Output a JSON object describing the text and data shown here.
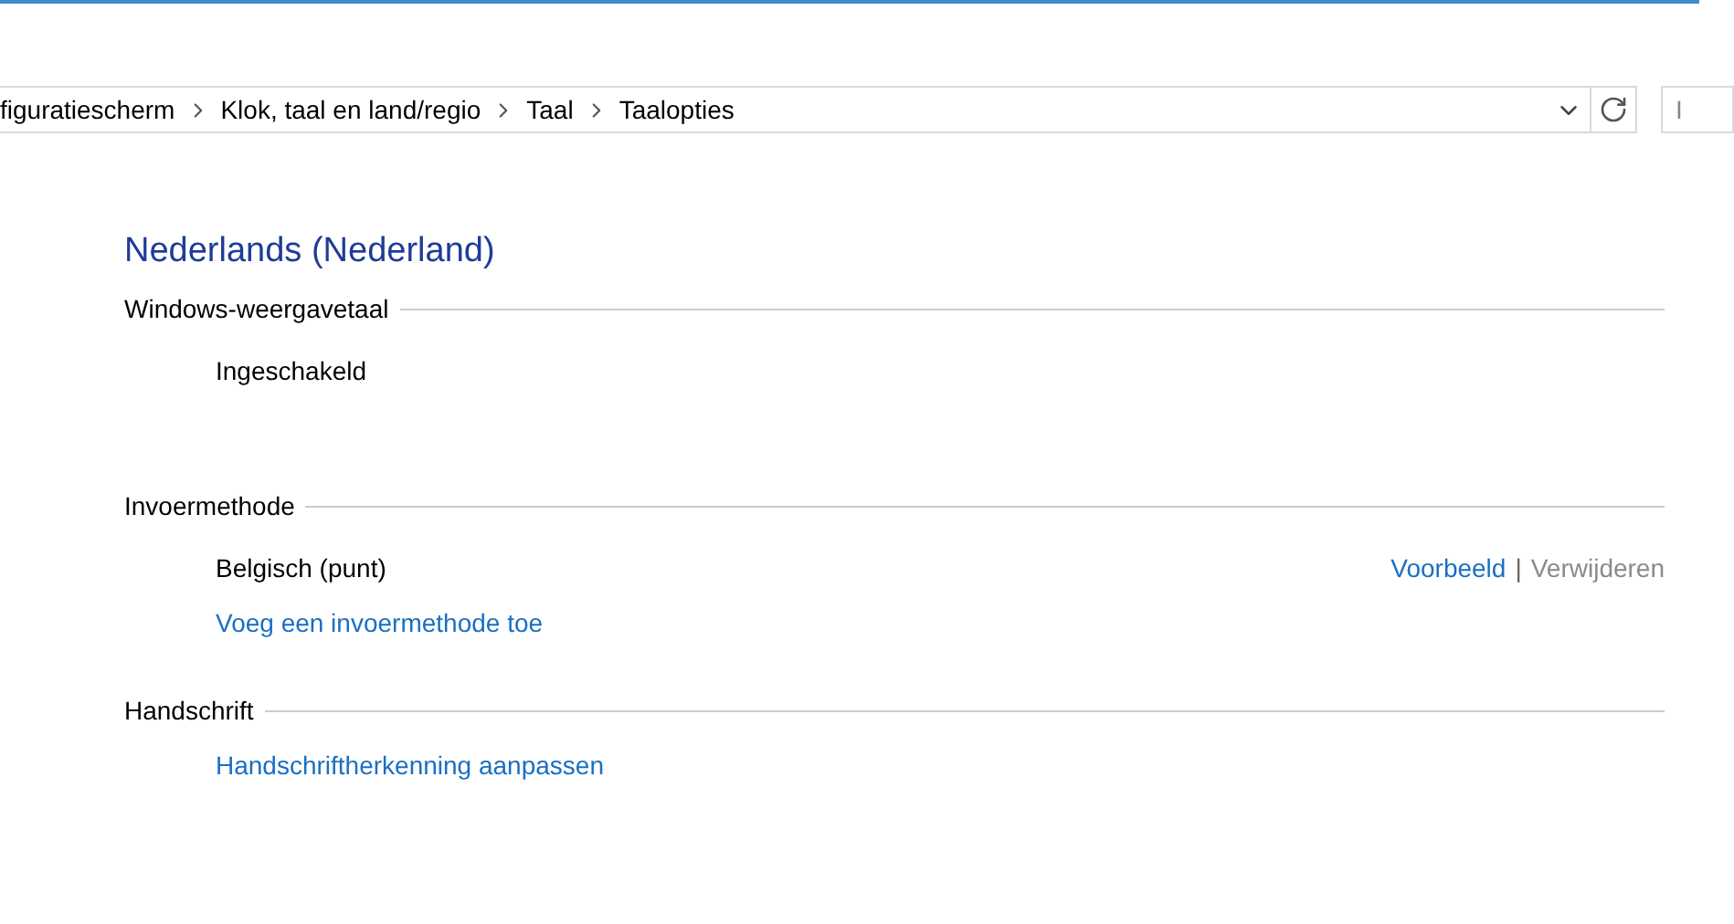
{
  "address_bar": {
    "breadcrumbs": [
      "figuratiescherm",
      "Klok, taal en land/regio",
      "Taal",
      "Taalopties"
    ]
  },
  "search": {
    "placeholder": "I"
  },
  "title": "Nederlands (Nederland)",
  "sections": [
    {
      "heading": "Windows-weergavetaal",
      "rows": [
        {
          "kind": "text",
          "label": "Ingeschakeld"
        }
      ]
    },
    {
      "heading": "Invoermethode",
      "rows": [
        {
          "kind": "item",
          "label": "Belgisch (punt)",
          "separator": "|",
          "actions": [
            {
              "label": "Voorbeeld",
              "disabled": false
            },
            {
              "label": "Verwijderen",
              "disabled": true
            }
          ]
        },
        {
          "kind": "link",
          "label": "Voeg een invoermethode toe"
        }
      ]
    },
    {
      "heading": "Handschrift",
      "rows": [
        {
          "kind": "link",
          "label": "Handschriftherkenning aanpassen"
        }
      ]
    }
  ]
}
